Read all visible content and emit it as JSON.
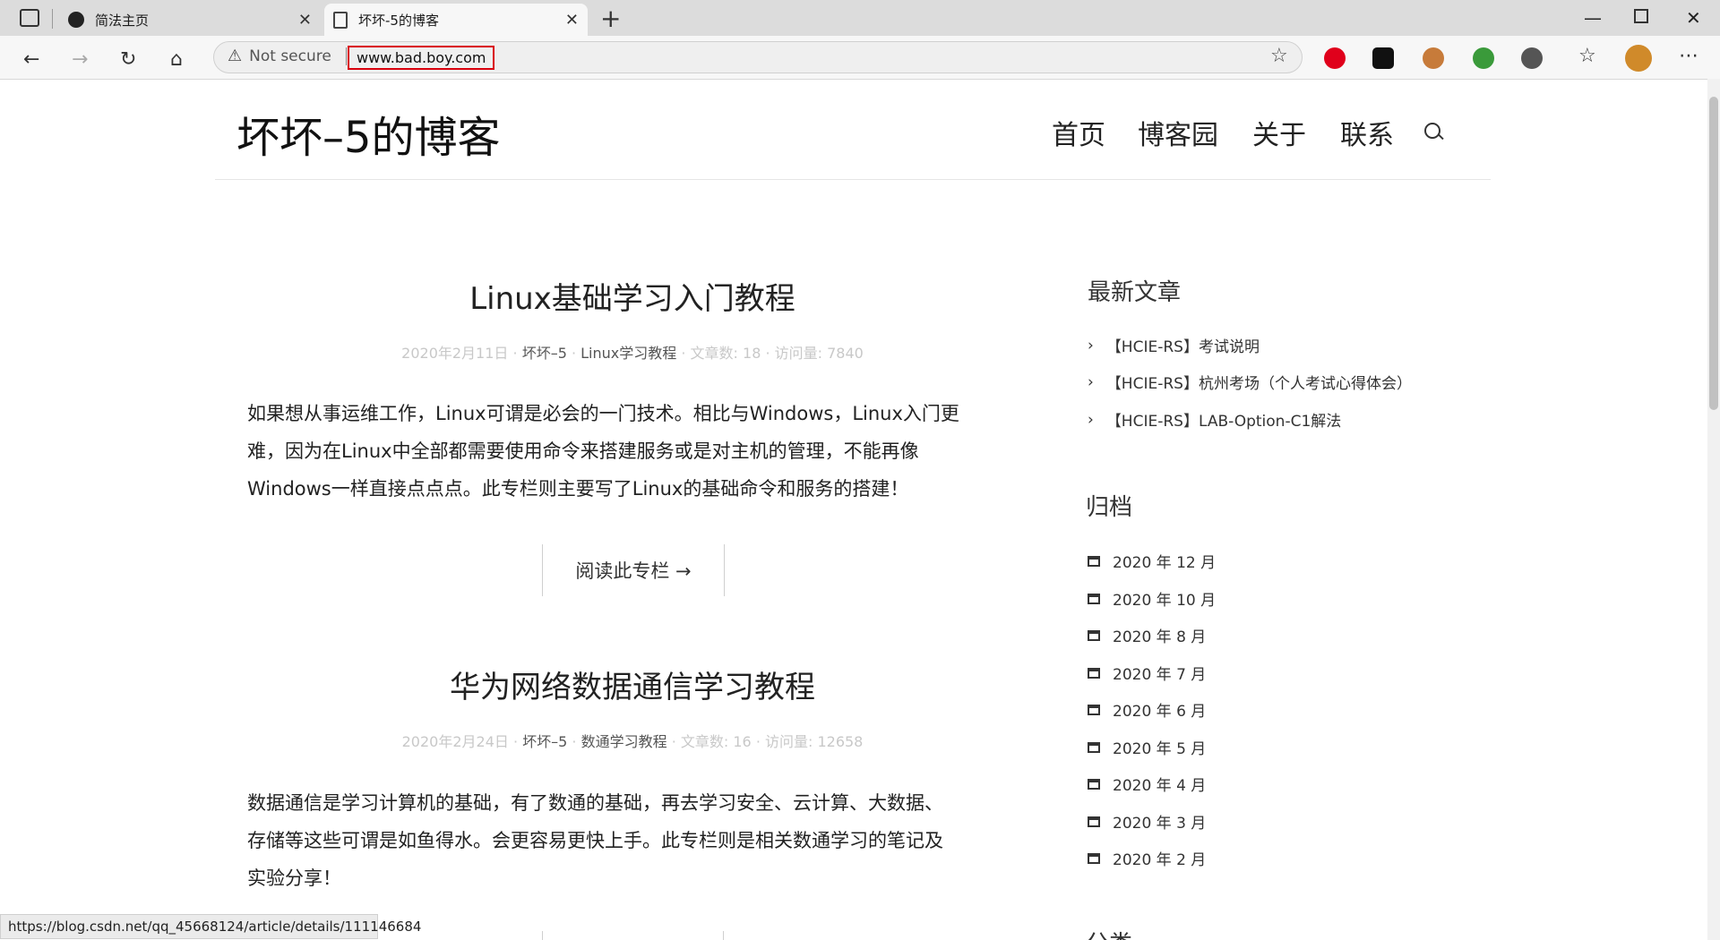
{
  "browser": {
    "tabs": [
      {
        "label": "简法主页"
      },
      {
        "label": "坏坏-5的博客"
      }
    ],
    "not_secure_label": "Not secure",
    "url": "www.bad.boy.com",
    "status_url": "https://blog.csdn.net/qq_45668124/article/details/111146684",
    "icons": [
      "sidebar-icon",
      "new-tab-icon",
      "back-icon",
      "forward-icon",
      "refresh-icon",
      "home-icon",
      "warning-icon",
      "favorite-add-icon",
      "opera-icon",
      "extension-icon",
      "monkey-icon",
      "globe-icon",
      "dots-icon",
      "favorites-icon",
      "profile-avatar",
      "more-icon"
    ]
  },
  "site": {
    "title": "坏坏–5的博客",
    "nav": [
      "首页",
      "博客园",
      "关于",
      "联系"
    ]
  },
  "posts": [
    {
      "title": "Linux基础学习入门教程",
      "date": "2020年2月11日",
      "author": "坏坏–5",
      "category": "Linux学习教程",
      "count": "文章数: 18",
      "views": "访问量: 7840",
      "excerpt": [
        "如果想从事运维工作，Linux可谓是必会的一门技术。相比与Windows，Linux入门更",
        "难，因为在Linux中全部都需要使用命令来搭建服务或是对主机的管理，不能再像",
        "Windows一样直接点点点。此专栏则主要写了Linux的基础命令和服务的搭建！"
      ],
      "read_label": "阅读此专栏 →"
    },
    {
      "title": "华为网络数据通信学习教程",
      "date": "2020年2月24日",
      "author": "坏坏–5",
      "category": "数通学习教程",
      "count": "文章数: 16",
      "views": "访问量: 12658",
      "excerpt": [
        "数据通信是学习计算机的基础，有了数通的基础，再去学习安全、云计算、大数据、",
        "存储等这些可谓是如鱼得水。会更容易更快上手。此专栏则是相关数通学习的笔记及",
        "实验分享！"
      ]
    }
  ],
  "sidebar": {
    "recent_heading": "最新文章",
    "recent": [
      "【HCIE-RS】考试说明",
      "【HCIE-RS】杭州考场（个人考试心得体会）",
      "【HCIE-RS】LAB-Option-C1解法"
    ],
    "archive_heading": "归档",
    "archives": [
      "2020 年 12 月",
      "2020 年 10 月",
      "2020 年 8 月",
      "2020 年 7 月",
      "2020 年 6 月",
      "2020 年 5 月",
      "2020 年 4 月",
      "2020 年 3 月",
      "2020 年 2 月"
    ],
    "next_heading": "分类"
  }
}
